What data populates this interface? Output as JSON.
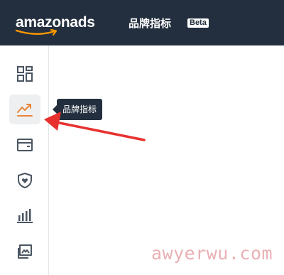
{
  "header": {
    "logo_text": "amazonads",
    "app_title": "品牌指标",
    "badge": "Beta"
  },
  "sidebar": {
    "items": [
      {
        "icon": "dashboard-grid-icon",
        "active": false
      },
      {
        "icon": "trending-up-icon",
        "active": true
      },
      {
        "icon": "wallet-icon",
        "active": false
      },
      {
        "icon": "shield-heart-icon",
        "active": false
      },
      {
        "icon": "bar-chart-icon",
        "active": false
      },
      {
        "icon": "image-gallery-icon",
        "active": false
      }
    ],
    "tooltip": "品牌指标"
  },
  "annotation": {
    "type": "red-arrow",
    "color": "#e8312f"
  },
  "watermark": "awyerwu.com",
  "colors": {
    "header_bg": "#232f3e",
    "accent_orange": "#e8853a",
    "icon": "#4a5561"
  }
}
